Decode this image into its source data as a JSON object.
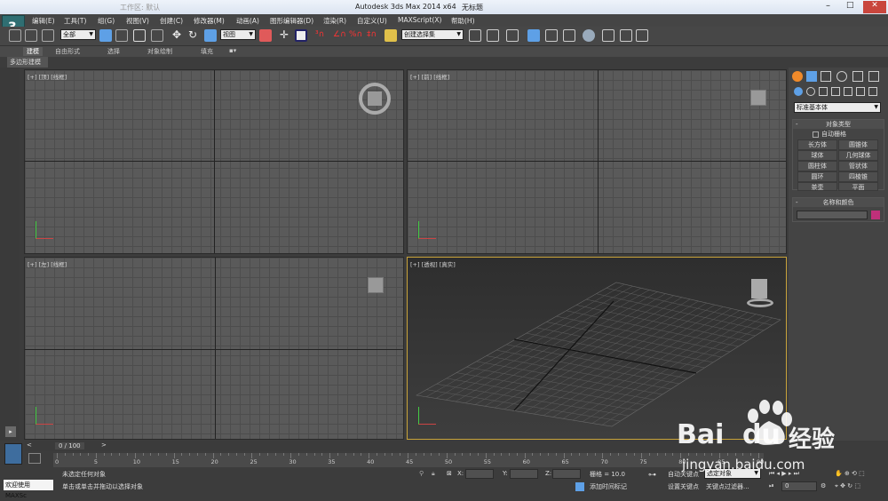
{
  "title_bar": {
    "quick_access": "工作区: 默认",
    "app_title": "Autodesk 3ds Max  2014 x64",
    "doc_title": "无标题"
  },
  "menu": [
    "编辑(E)",
    "工具(T)",
    "组(G)",
    "视图(V)",
    "创建(C)",
    "修改器(M)",
    "动画(A)",
    "图形编辑器(D)",
    "渲染(R)",
    "自定义(U)",
    "MAXScript(X)",
    "帮助(H)"
  ],
  "toolbar": {
    "selection_filter": "全部",
    "ref_coord": "视图",
    "named_selection": "创建选择集"
  },
  "ribbon_tabs": [
    "建模",
    "自由形式",
    "选择",
    "对象绘制",
    "填充"
  ],
  "ribbon_subtab": "多边形建模",
  "viewports": {
    "top": "[+] [顶] [线框]",
    "front": "[+] [前] [线框]",
    "left": "[+] [左] [线框]",
    "perspective": "[+] [透视] [真实]"
  },
  "command_panel": {
    "category_dropdown": "标准基本体",
    "rollout_object_type": "对象类型",
    "autogrid_label": "自动栅格",
    "object_buttons": [
      "长方体",
      "圆锥体",
      "球体",
      "几何球体",
      "圆柱体",
      "管状体",
      "圆环",
      "四棱锥",
      "茶壶",
      "平面"
    ],
    "rollout_name_color": "名称和颜色",
    "object_color": "#c0307a"
  },
  "timeline": {
    "frame_counter": "0 / 100",
    "ticks": [
      "0",
      "5",
      "10",
      "15",
      "20",
      "25",
      "30",
      "35",
      "40",
      "45",
      "50",
      "55",
      "60",
      "65",
      "70",
      "75",
      "80",
      "85",
      "90"
    ]
  },
  "status": {
    "welcome": "欢迎使用 MAXSc",
    "line1": "未选定任何对象",
    "line2": "单击或单击并拖动以选择对象",
    "x_label": "X:",
    "y_label": "Y:",
    "z_label": "Z:",
    "grid": "栅格 = 10.0",
    "auto_key": "自动关键点",
    "set_key": "设置关键点",
    "selected_dropdown": "选定对象",
    "key_filters": "关键点过滤器...",
    "add_time_tag": "添加时间标记",
    "frame_field": "0"
  },
  "watermark": {
    "brand": "Bai",
    "brand_suffix": "du",
    "jingyan": "经验",
    "url": "jingyan.baidu.com"
  }
}
